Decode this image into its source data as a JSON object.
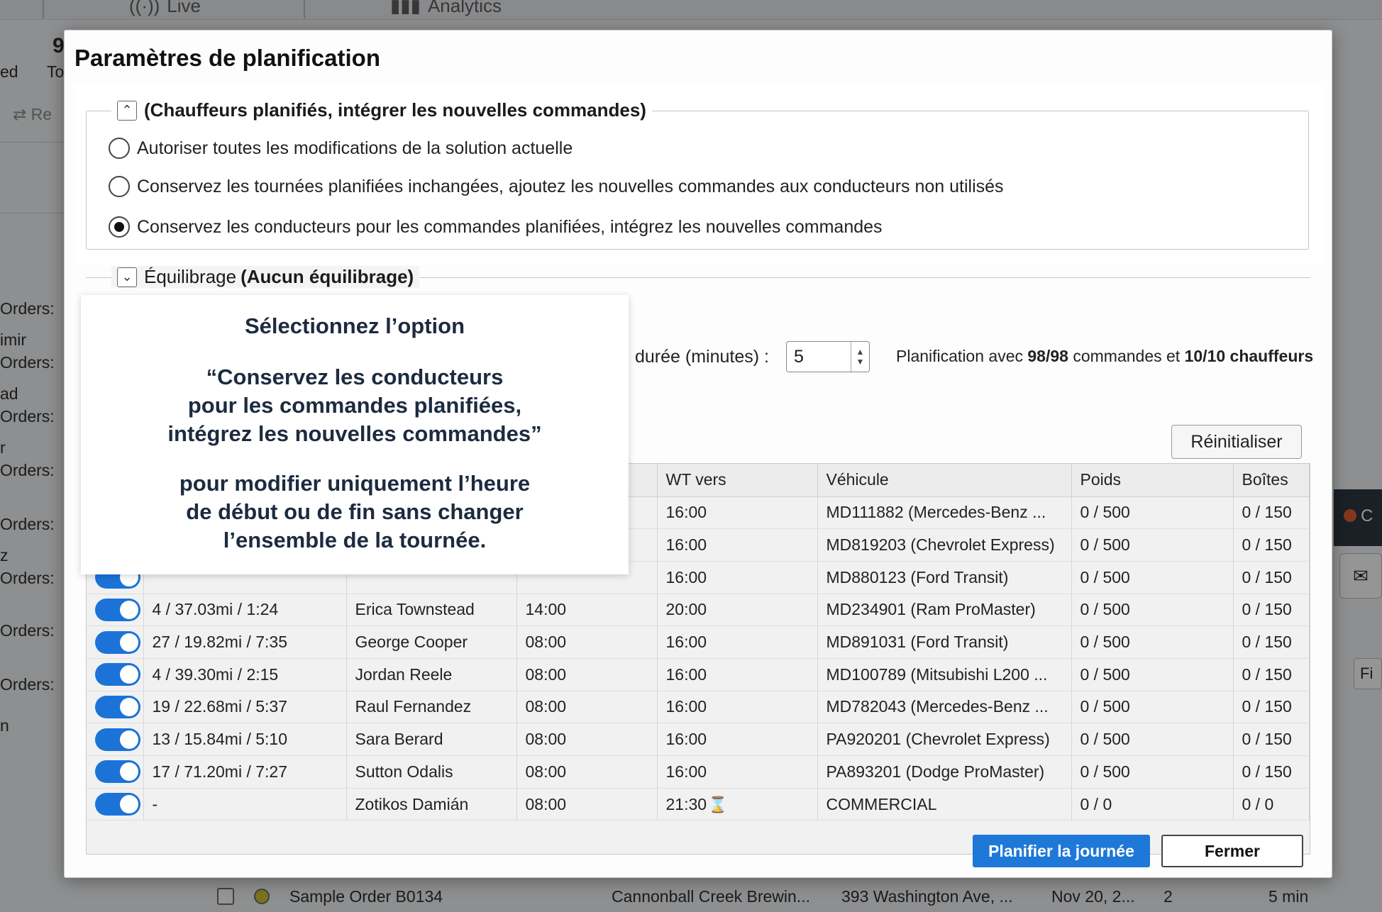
{
  "background": {
    "tabs": [
      "Live",
      "Analytics"
    ],
    "header_fragments": [
      "9",
      "ed",
      "To",
      "Re"
    ],
    "side_labels": [
      "Orders:",
      "imir",
      "Orders:",
      "ad",
      "Orders:",
      "r",
      "Orders:",
      "Orders:",
      "z",
      "Orders:",
      "Orders:",
      "Orders:",
      "n"
    ],
    "bottom_row": {
      "name": "Sample Order B0134",
      "customer": "Cannonball Creek Brewin...",
      "address": "393 Washington Ave, ...",
      "date": "Nov 20, 2...",
      "qty": "2",
      "duration": "5 min"
    },
    "right_fragments": [
      "C",
      "Fi"
    ]
  },
  "dialog": {
    "title": "Paramètres de planification",
    "section1": {
      "legend": "(Chauffeurs planifiés, intégrer les nouvelles commandes)",
      "options": [
        "Autoriser toutes les modifications de la solution actuelle",
        "Conservez les tournées planifiées inchangées, ajoutez les nouvelles commandes aux conducteurs non utilisés",
        "Conservez les conducteurs pour les commandes planifiées, intégrez les nouvelles commandes"
      ],
      "selected_index": 2
    },
    "section2": {
      "legend_prefix": "Équilibrage",
      "legend_bold": "(Aucun équilibrage)"
    },
    "duration_label": "durée (minutes) :",
    "duration_value": "5",
    "summary": {
      "prefix": "Planification avec",
      "orders": "98/98",
      "middle": "commandes et",
      "drivers": "10/10 chauffeurs"
    },
    "reset_label": "Réinitialiser",
    "table": {
      "columns": [
        "",
        "",
        "",
        "",
        "WT vers",
        "Véhicule",
        "Poids",
        "Boîtes"
      ],
      "rows": [
        {
          "stats": "",
          "driver": "",
          "start": "",
          "end": "16:00",
          "vehicle": "MD111882 (Mercedes-Benz ...",
          "weight": "0 / 500",
          "boxes": "0 / 150"
        },
        {
          "stats": "",
          "driver": "",
          "start": "",
          "end": "16:00",
          "vehicle": "MD819203 (Chevrolet Express)",
          "weight": "0 / 500",
          "boxes": "0 / 150"
        },
        {
          "stats": "",
          "driver": "",
          "start": "",
          "end": "16:00",
          "vehicle": "MD880123 (Ford Transit)",
          "weight": "0 / 500",
          "boxes": "0 / 150"
        },
        {
          "stats": "4 / 37.03mi / 1:24",
          "driver": "Erica Townstead",
          "start": "14:00",
          "end": "20:00",
          "vehicle": "MD234901 (Ram ProMaster)",
          "weight": "0 / 500",
          "boxes": "0 / 150"
        },
        {
          "stats": "27 / 19.82mi / 7:35",
          "driver": "George Cooper",
          "start": "08:00",
          "end": "16:00",
          "vehicle": "MD891031 (Ford Transit)",
          "weight": "0 / 500",
          "boxes": "0 / 150"
        },
        {
          "stats": "4 / 39.30mi / 2:15",
          "driver": "Jordan Reele",
          "start": "08:00",
          "end": "16:00",
          "vehicle": "MD100789 (Mitsubishi L200 ...",
          "weight": "0 / 500",
          "boxes": "0 / 150"
        },
        {
          "stats": "19 / 22.68mi / 5:37",
          "driver": "Raul Fernandez",
          "start": "08:00",
          "end": "16:00",
          "vehicle": "MD782043 (Mercedes-Benz ...",
          "weight": "0 / 500",
          "boxes": "0 / 150"
        },
        {
          "stats": "13 / 15.84mi / 5:10",
          "driver": "Sara Berard",
          "start": "08:00",
          "end": "16:00",
          "vehicle": "PA920201 (Chevrolet Express)",
          "weight": "0 / 500",
          "boxes": "0 / 150"
        },
        {
          "stats": "17 / 71.20mi / 7:27",
          "driver": "Sutton Odalis",
          "start": "08:00",
          "end": "16:00",
          "vehicle": "PA893201 (Dodge ProMaster)",
          "weight": "0 / 500",
          "boxes": "0 / 150"
        },
        {
          "stats": "-",
          "driver": "Zotikos Damián",
          "start": "08:00",
          "end": "21:30",
          "vehicle": "COMMERCIAL",
          "weight": "0 / 0",
          "boxes": "0 / 0"
        }
      ]
    },
    "plan_button": "Planifier la journée",
    "close_button": "Fermer"
  },
  "callout": {
    "line1": "Sélectionnez l’option",
    "quote": [
      "“Conservez les conducteurs",
      "pour les commandes planifiées,",
      "intégrez les nouvelles commandes”"
    ],
    "explain": [
      "pour modifier uniquement l’heure",
      "de début ou de fin sans changer",
      "l’ensemble de la tournée."
    ]
  },
  "colors": {
    "accent": "#1e78d8",
    "callout_text": "#1d2b3f"
  }
}
